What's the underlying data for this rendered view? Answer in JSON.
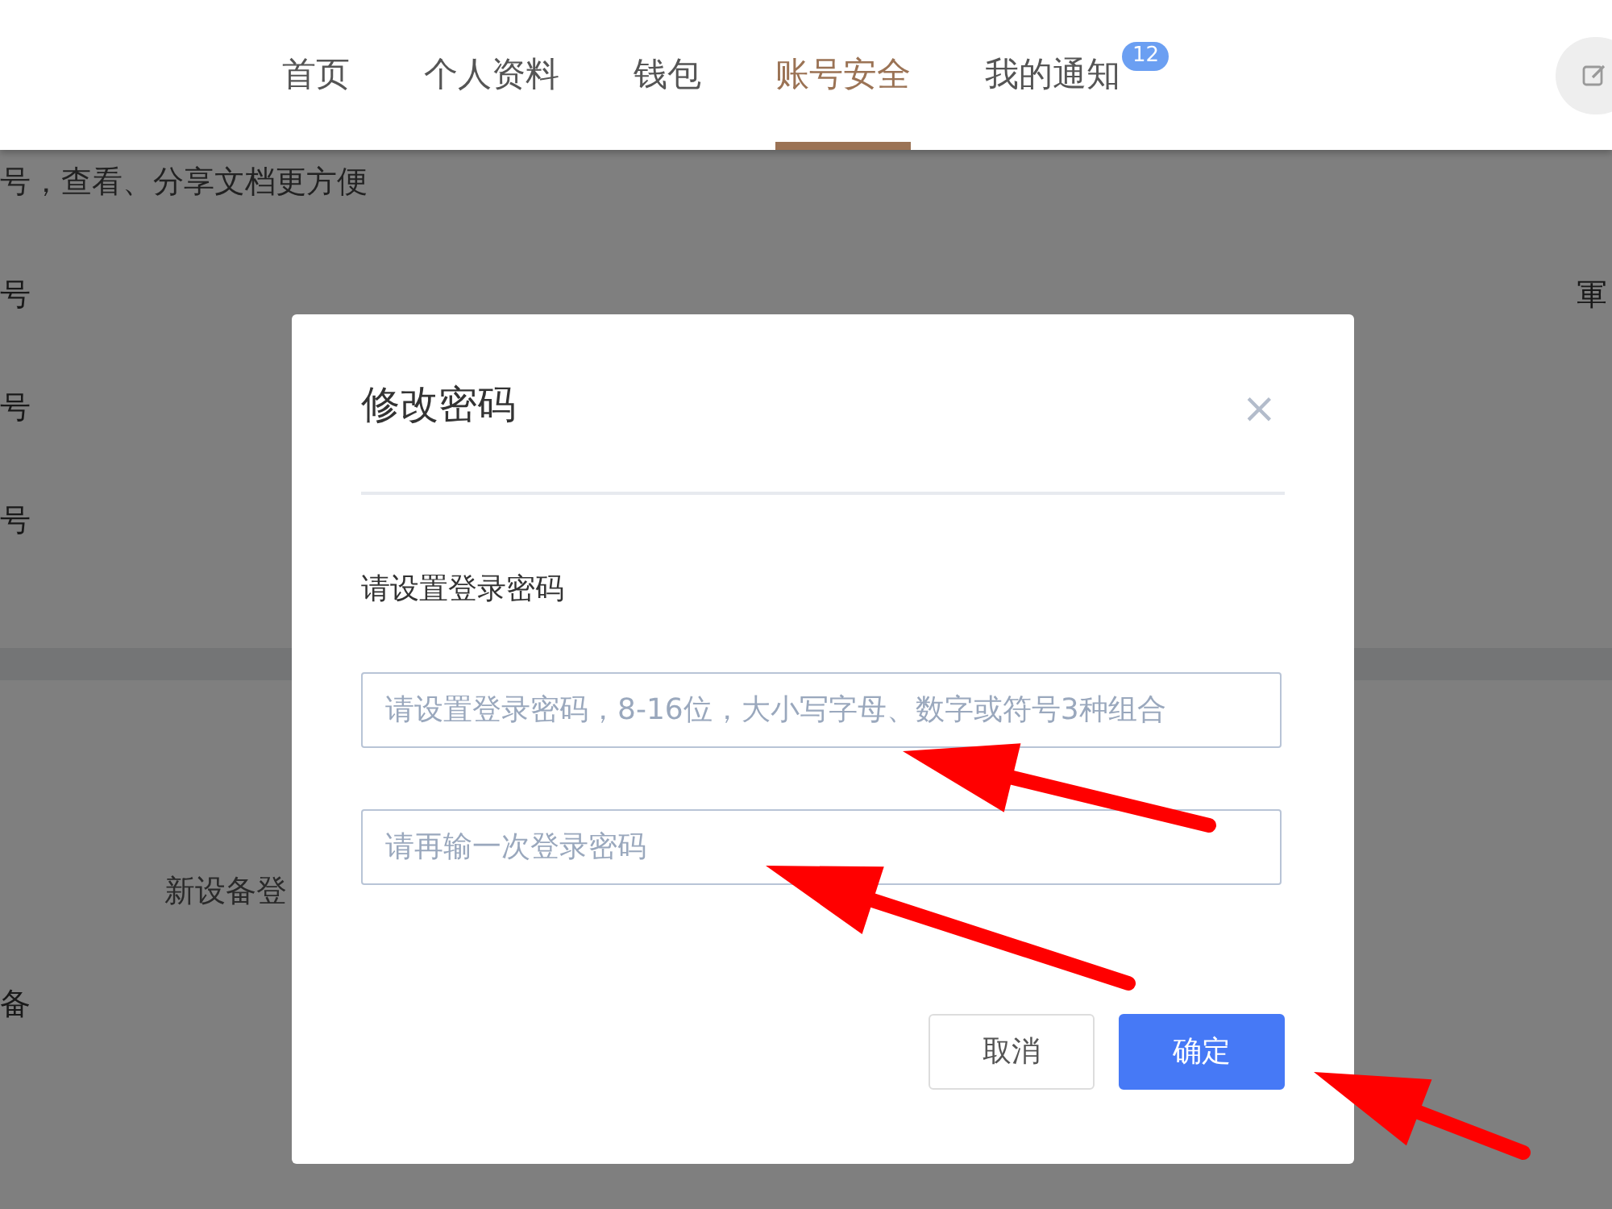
{
  "nav": {
    "tabs": [
      {
        "label": "首页",
        "selected": false
      },
      {
        "label": "个人资料",
        "selected": false
      },
      {
        "label": "钱包",
        "selected": false
      },
      {
        "label": "账号安全",
        "selected": true
      },
      {
        "label": "我的通知",
        "selected": false,
        "badge": "12"
      }
    ]
  },
  "background": {
    "intro": "号，查看、分享文档更方便",
    "rows": [
      {
        "label": "号",
        "right": "軍"
      },
      {
        "label": "号"
      },
      {
        "label": "号"
      }
    ],
    "device_setting": "新设备登",
    "device_row": "备"
  },
  "dialog": {
    "title": "修改密码",
    "close": "×",
    "label": "请设置登录密码",
    "fields": [
      {
        "placeholder": "请设置登录密码，8-16位，大小写字母、数字或符号3种组合"
      },
      {
        "placeholder": "请再输一次登录密码"
      }
    ],
    "buttons": [
      {
        "label": "取消",
        "kind": "secondary"
      },
      {
        "label": "确定",
        "kind": "primary"
      }
    ]
  }
}
